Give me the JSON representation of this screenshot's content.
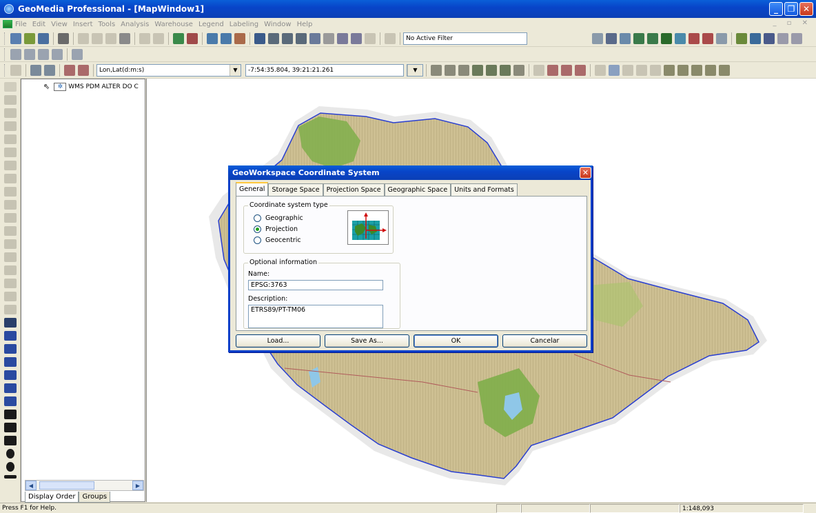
{
  "app": {
    "title": "GeoMedia Professional - [MapWindow1]"
  },
  "menu": [
    "File",
    "Edit",
    "View",
    "Insert",
    "Tools",
    "Analysis",
    "Warehouse",
    "Legend",
    "Labeling",
    "Window",
    "Help"
  ],
  "toolbar": {
    "filter_combo": "No Active Filter",
    "coord_format_combo": "Lon,Lat(d:m:s)",
    "coord_readout": "-7:54:35.804, 39:21:21.261"
  },
  "legend": {
    "entry": "WMS PDM ALTER DO C",
    "tabs": [
      "Display Order",
      "Groups"
    ]
  },
  "dialog": {
    "title": "GeoWorkspace Coordinate System",
    "tabs": [
      "General",
      "Storage Space",
      "Projection Space",
      "Geographic Space",
      "Units and Formats"
    ],
    "active_tab": "General",
    "cs_type_group": "Coordinate system type",
    "cs_options": [
      "Geographic",
      "Projection",
      "Geocentric"
    ],
    "cs_selected": "Projection",
    "optional_group": "Optional information",
    "name_label": "Name:",
    "name_value": "EPSG:3763",
    "description_label": "Description:",
    "description_value": "ETRS89/PT-TM06",
    "buttons": {
      "load": "Load...",
      "save_as": "Save As...",
      "ok": "OK",
      "cancel": "Cancelar"
    }
  },
  "status": {
    "help": "Press F1 for Help.",
    "scale": "1:148,093"
  },
  "colors": {
    "titlebar": "#0845c9",
    "map_fill": "#c9b98a",
    "map_border": "#2a3fd0",
    "forest": "#7fae4a",
    "water": "#8fc7e8"
  }
}
